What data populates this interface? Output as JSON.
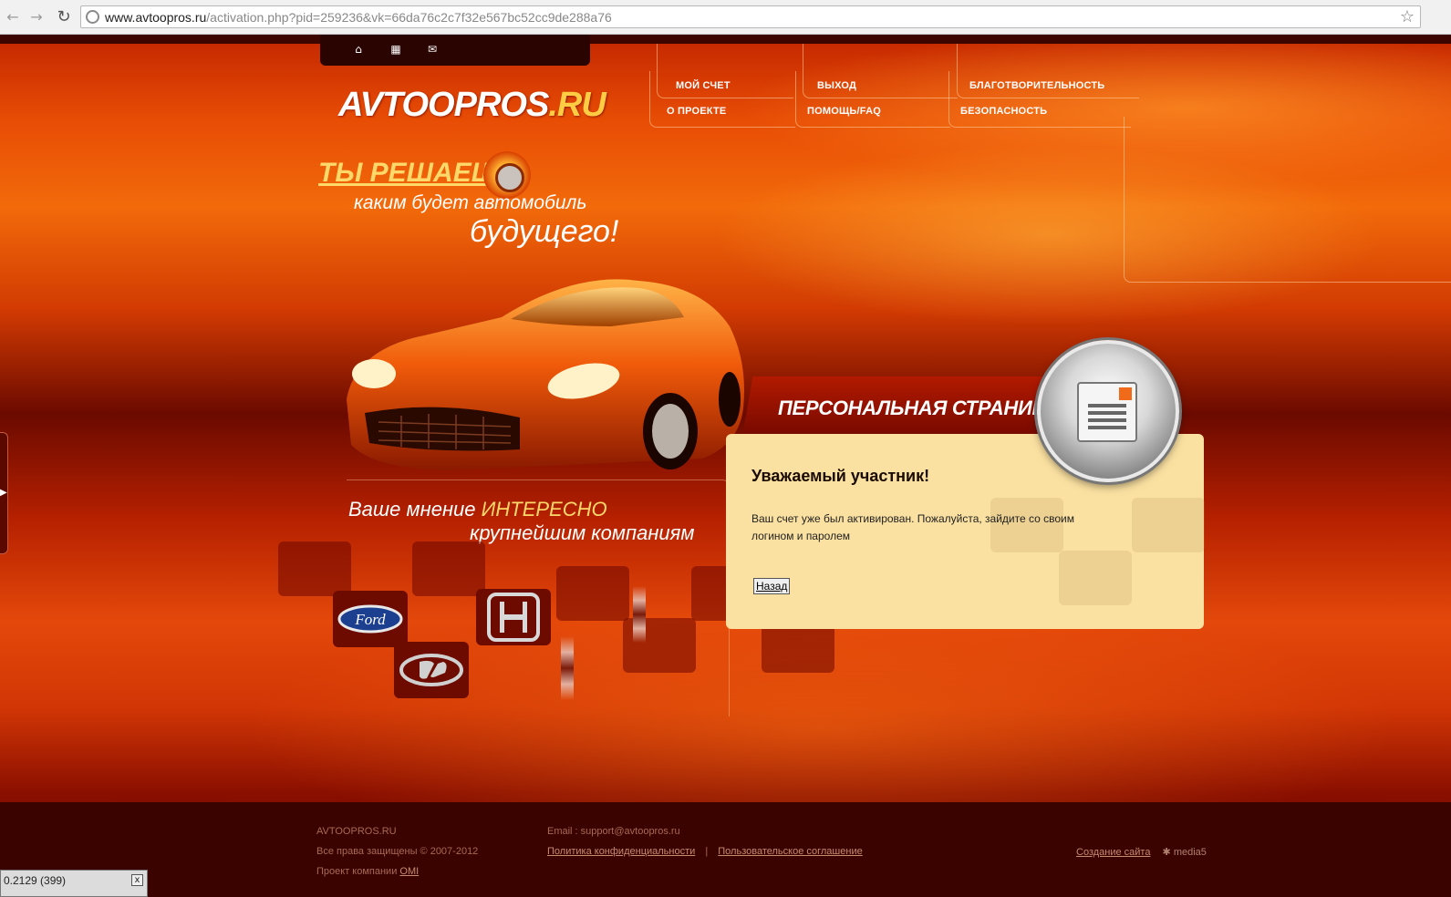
{
  "browser": {
    "url_domain": "www.avtoopros.ru",
    "url_rest": "/activation.php?pid=259236&vk=66da76c2c7f32e567bc52cc9de288a76"
  },
  "header": {
    "logo_main": "AVTOOPROS",
    "logo_suffix": ".RU",
    "menu": {
      "my_account": "МОЙ СЧЕТ",
      "logout": "ВЫХОД",
      "charity": "БЛАГОТВОРИТЕЛЬНОСТЬ",
      "about": "О ПРОЕКТЕ",
      "help": "ПОМОЩЬ/FAQ",
      "security": "БЕЗОПАСНОСТЬ"
    }
  },
  "slogan": {
    "line1": "ТЫ РЕШАЕШЬ,",
    "line2": "каким будет автомобиль",
    "line3": "будущего!"
  },
  "opinion": {
    "part1": "Ваше мнение ",
    "highlight": "ИНТЕРЕСНО",
    "line2": "крупнейшим компаниям"
  },
  "brands": {
    "ford": "Ford"
  },
  "card": {
    "title": "ПЕРСОНАЛЬНАЯ СТРАНИЦА",
    "heading": "Уважаемый участник!",
    "message": "Ваш счет уже был активирован. Пожалуйста, зайдите со своим логином и паролем",
    "back_label": "Назад"
  },
  "footer": {
    "site": "AVTOOPROS.RU",
    "rights": "Все права защищены © 2007-2012",
    "project_prefix": "Проект компании ",
    "project_link": "OMI",
    "email": "Email : support@avtoopros.ru",
    "privacy": "Политика конфиденциальности",
    "separator": "|",
    "agreement": "Пользовательское соглашение",
    "creation": "Создание сайта",
    "studio": "media5"
  },
  "overlay": {
    "text": "0.2129 (399)",
    "close": "x"
  },
  "colors": {
    "accent_yellow": "#ffd86a",
    "card_bg": "#fbe1a1",
    "footer_bg": "#3a0300"
  }
}
